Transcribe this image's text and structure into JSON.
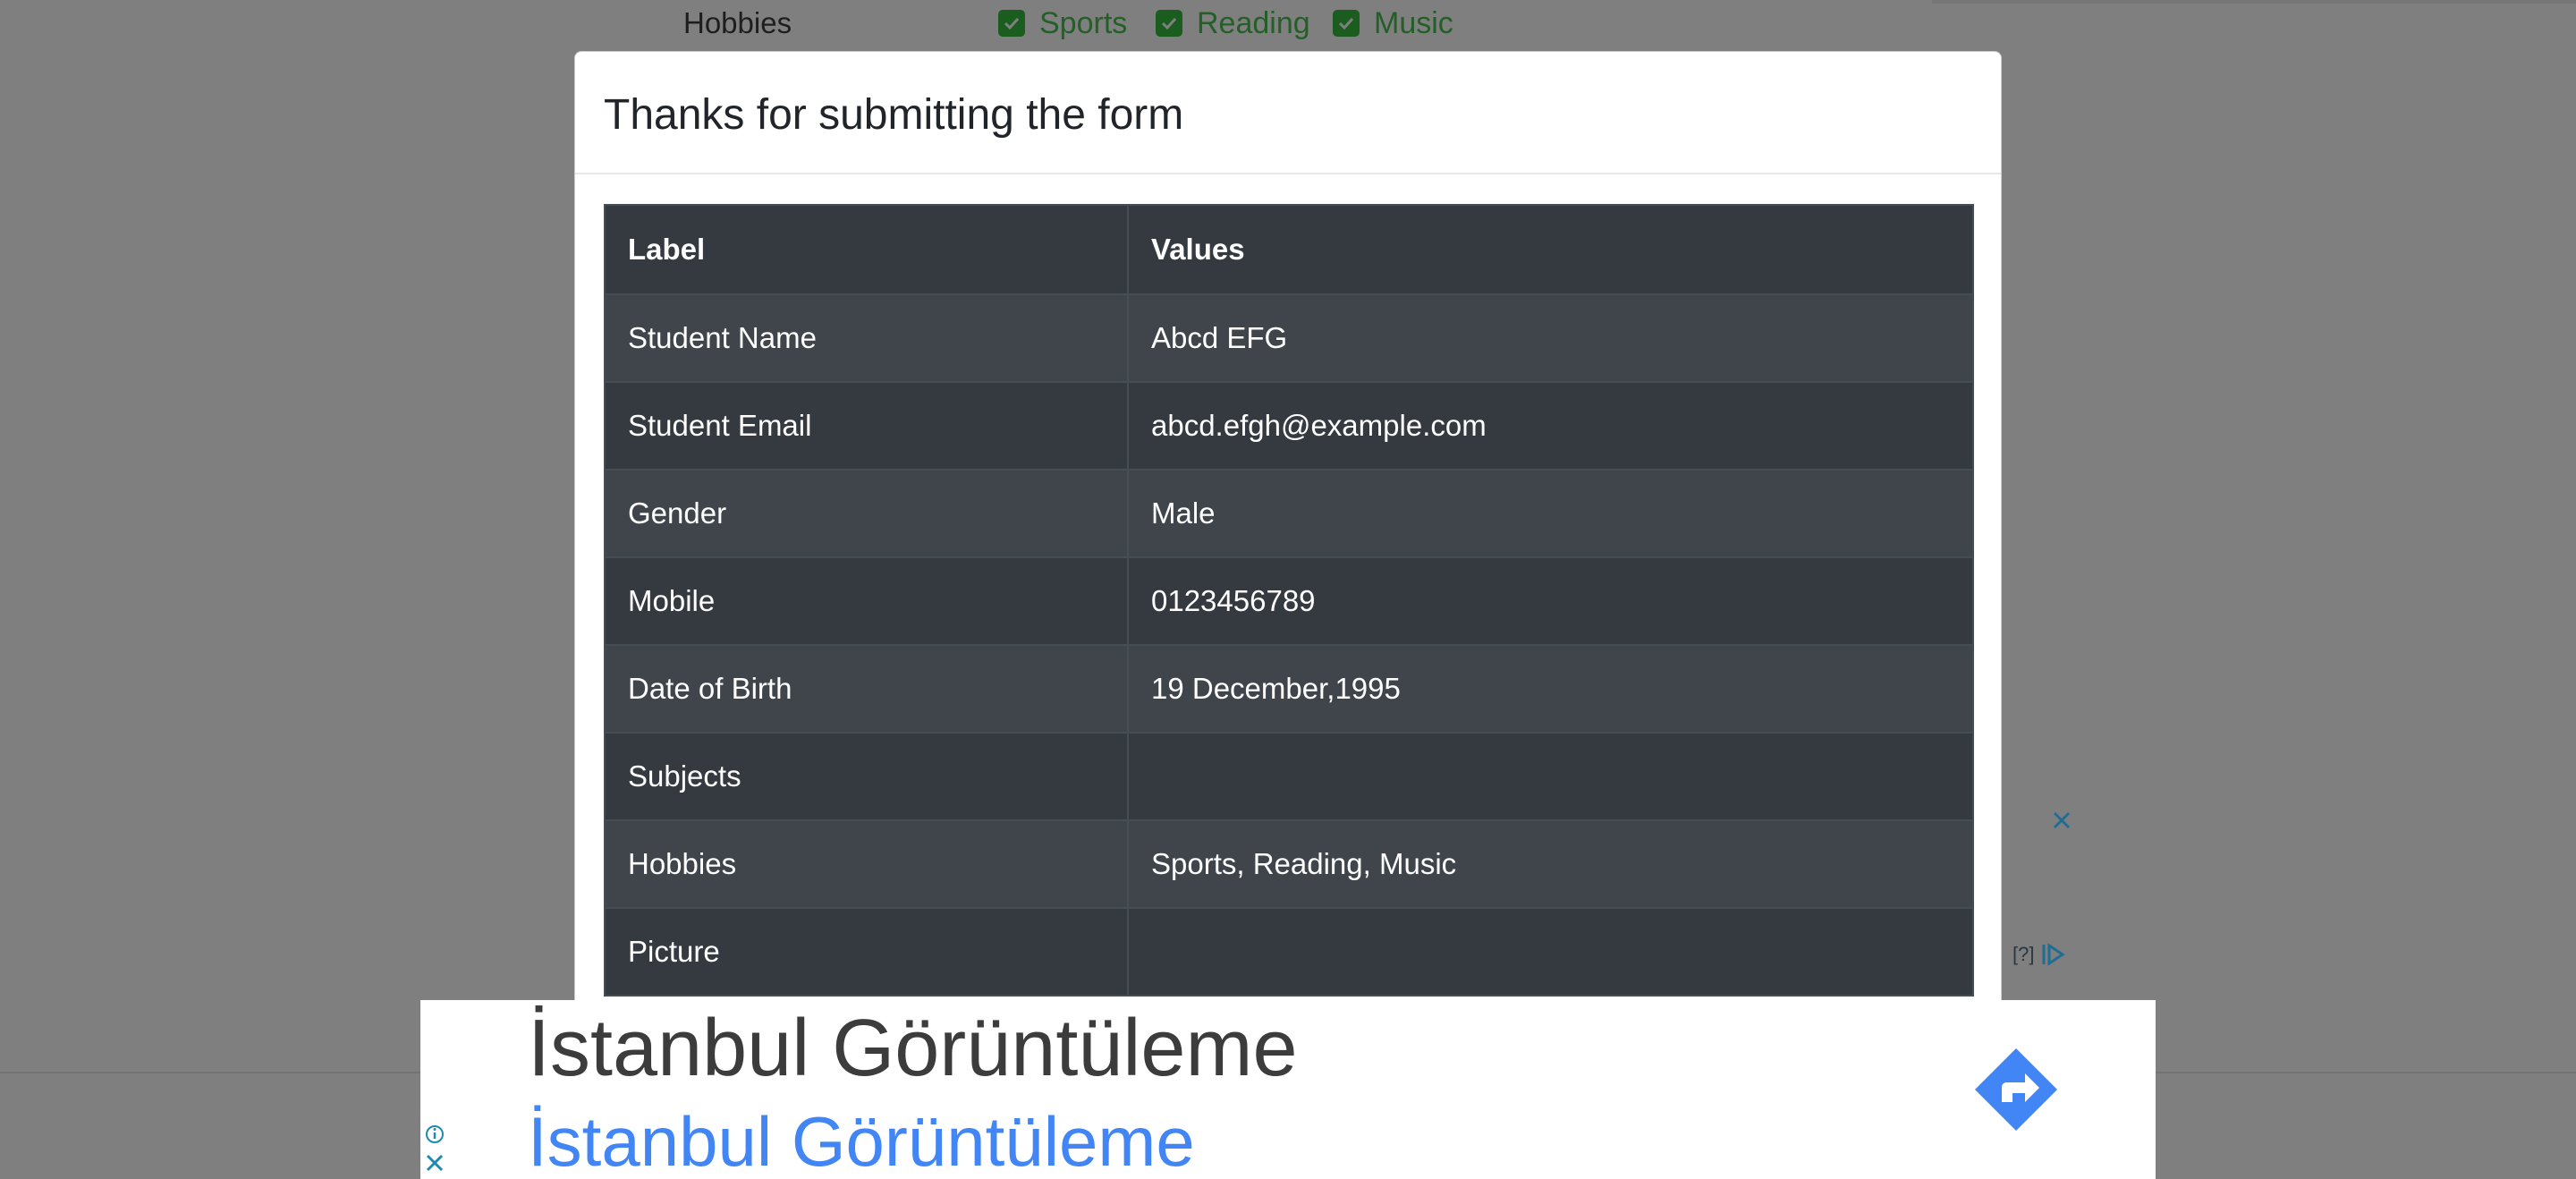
{
  "background": {
    "hobbies_label": "Hobbies",
    "hobbies": [
      {
        "label": "Sports",
        "checked": true
      },
      {
        "label": "Reading",
        "checked": true
      },
      {
        "label": "Music",
        "checked": true
      }
    ],
    "side_ad_info": "[?]"
  },
  "modal": {
    "title": "Thanks for submitting the form",
    "table": {
      "headers": [
        "Label",
        "Values"
      ],
      "rows": [
        {
          "label": "Student Name",
          "value": "Abcd EFG"
        },
        {
          "label": "Student Email",
          "value": "abcd.efgh@example.com"
        },
        {
          "label": "Gender",
          "value": "Male"
        },
        {
          "label": "Mobile",
          "value": "0123456789"
        },
        {
          "label": "Date of Birth",
          "value": "19 December,1995"
        },
        {
          "label": "Subjects",
          "value": ""
        },
        {
          "label": "Hobbies",
          "value": "Sports, Reading, Music"
        },
        {
          "label": "Picture",
          "value": ""
        }
      ]
    }
  },
  "ad_banner": {
    "title": "İstanbul Görüntüleme",
    "subtitle": "İstanbul Görüntüleme",
    "icons": [
      "info-icon",
      "close-icon",
      "directions-icon"
    ]
  },
  "colors": {
    "overlay": "#7f7f7f",
    "table_dark": "#343a40",
    "table_stripe": "#3f454b",
    "checkbox_green": "#1a5d1f",
    "hobby_text_green": "#245f27",
    "ad_blue": "#4285f4",
    "ad_close_teal": "#1e8ab0"
  }
}
